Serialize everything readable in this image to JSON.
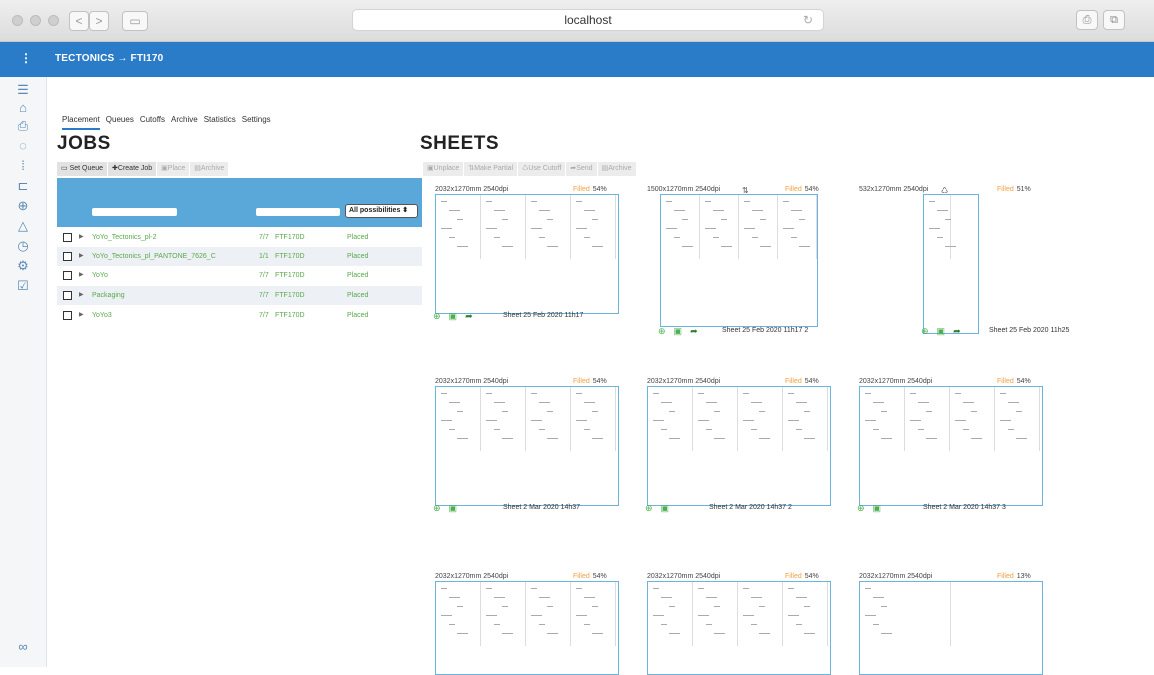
{
  "browser": {
    "url": "localhost",
    "back": "<",
    "forward": ">",
    "sidebar_toggle": "▭",
    "reload": "↻",
    "share": "⎙",
    "tabs": "⧉"
  },
  "header": {
    "menu": "⋮",
    "breadcrumb": "TECTONICS → FTI170"
  },
  "tabs": [
    "Placement",
    "Queues",
    "Cutoffs",
    "Archive",
    "Statistics",
    "Settings"
  ],
  "jobs": {
    "title": "JOBS",
    "toolbar": [
      "Set Queue",
      "Create Job",
      "Place",
      "Archive"
    ],
    "filter_select": "All possibilities",
    "rows": [
      {
        "name": "YoYo_Tectonics_pl-2",
        "count": "7/7",
        "code": "FTF170D",
        "status": "Placed"
      },
      {
        "name": "YoYo_Tectonics_pl_PANTONE_7626_C",
        "count": "1/1",
        "code": "FTF170D",
        "status": "Placed"
      },
      {
        "name": "YoYo",
        "count": "7/7",
        "code": "FTF170D",
        "status": "Placed"
      },
      {
        "name": "Packaging",
        "count": "7/7",
        "code": "FTF170D",
        "status": "Placed"
      },
      {
        "name": "YoYo3",
        "count": "7/7",
        "code": "FTF170D",
        "status": "Placed"
      }
    ]
  },
  "sheets": {
    "title": "SHEETS",
    "toolbar": [
      "Unplace",
      "Make Partial",
      "Use Cutoff",
      "Send",
      "Archive"
    ],
    "filled_label": "Filled",
    "items": [
      {
        "dims": "2032x1270mm 2540dpi",
        "pct": "54%",
        "name": "Sheet 25 Feb 2020 11h17"
      },
      {
        "dims": "1500x1270mm 2540dpi",
        "pct": "54%",
        "name": "Sheet 25 Feb 2020 11h17 2"
      },
      {
        "dims": "532x1270mm 2540dpi",
        "pct": "51%",
        "name": "Sheet 25 Feb 2020 11h25"
      },
      {
        "dims": "2032x1270mm 2540dpi",
        "pct": "54%",
        "name": "Sheet 2 Mar 2020 14h37"
      },
      {
        "dims": "2032x1270mm 2540dpi",
        "pct": "54%",
        "name": "Sheet 2 Mar 2020 14h37 2"
      },
      {
        "dims": "2032x1270mm 2540dpi",
        "pct": "54%",
        "name": "Sheet 2 Mar 2020 14h37 3"
      },
      {
        "dims": "2032x1270mm 2540dpi",
        "pct": "54%",
        "name": ""
      },
      {
        "dims": "2032x1270mm 2540dpi",
        "pct": "54%",
        "name": ""
      },
      {
        "dims": "2032x1270mm 2540dpi",
        "pct": "13%",
        "name": ""
      }
    ]
  },
  "icons": {
    "crop": "⇅",
    "recycle": "♺",
    "plus": "⊕",
    "image": "▣",
    "send": "➦"
  },
  "colors": {
    "header": "#2a7bc8",
    "filter_bar": "#5aa7d9",
    "job_text": "#5aa84a",
    "filled": "#f0a040",
    "sheet_border": "#6cb4e0"
  }
}
